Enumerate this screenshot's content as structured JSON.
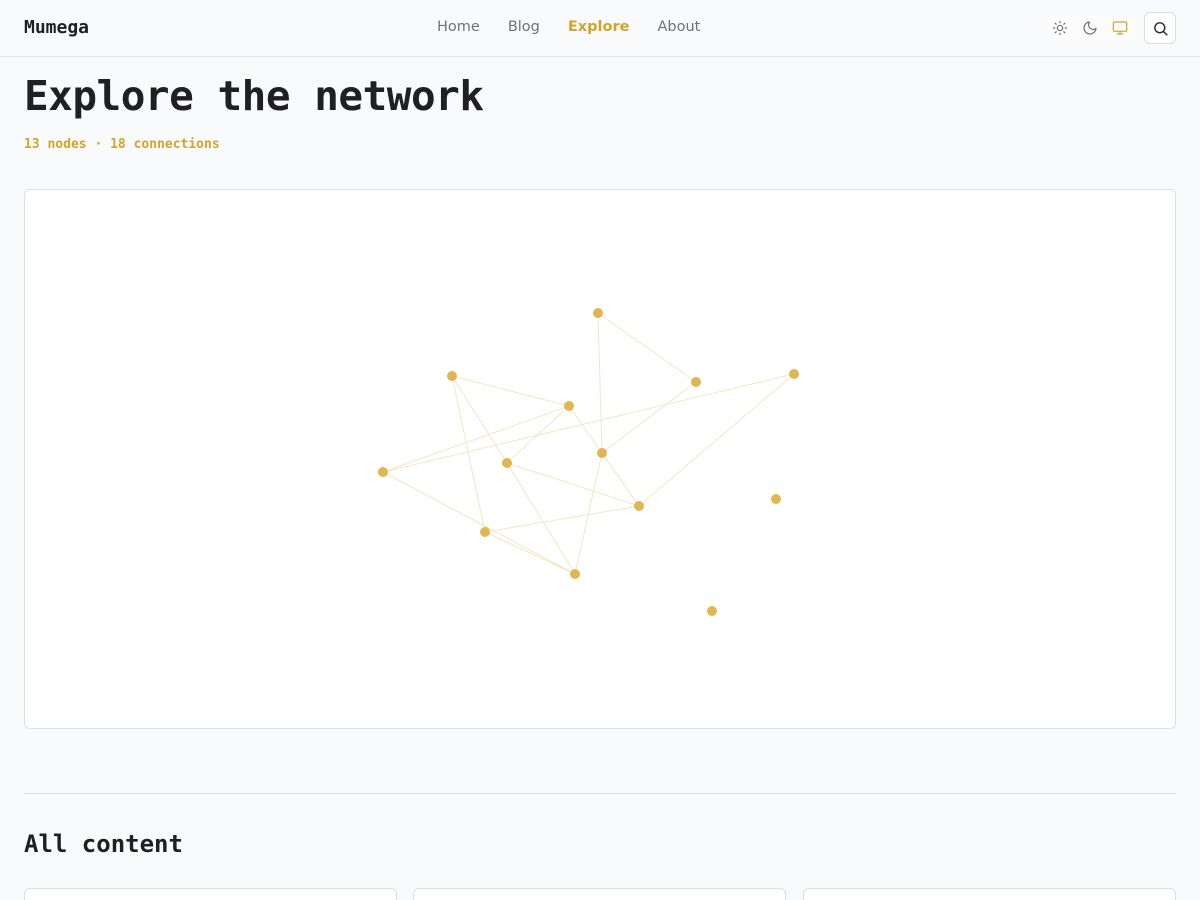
{
  "header": {
    "brand": "Mumega",
    "nav": [
      {
        "label": "Home",
        "active": false
      },
      {
        "label": "Blog",
        "active": false
      },
      {
        "label": "Explore",
        "active": true
      },
      {
        "label": "About",
        "active": false
      }
    ],
    "theme_toggle": {
      "options": [
        "sun-icon",
        "moon-icon",
        "monitor-icon"
      ],
      "selected": "monitor-icon"
    },
    "search_icon": "search-icon"
  },
  "main": {
    "title": "Explore the network",
    "stats": "13 nodes · 18 connections"
  },
  "graph": {
    "node_color": "#e0b650",
    "edge_color": "#f3e6c4",
    "nodes": [
      "n1",
      "n2",
      "n3",
      "n4",
      "n5",
      "n6",
      "n7",
      "n8",
      "n9",
      "n10",
      "n11",
      "n12",
      "n13"
    ],
    "edges": [
      [
        "n1",
        "n3"
      ],
      [
        "n1",
        "n6"
      ],
      [
        "n3",
        "n6"
      ],
      [
        "n2",
        "n4"
      ],
      [
        "n2",
        "n5"
      ],
      [
        "n2",
        "n8"
      ],
      [
        "n4",
        "n5"
      ],
      [
        "n4",
        "n7"
      ],
      [
        "n4",
        "n9"
      ],
      [
        "n5",
        "n9"
      ],
      [
        "n5",
        "n10"
      ],
      [
        "n8",
        "n9"
      ],
      [
        "n8",
        "n10"
      ],
      [
        "n6",
        "n9"
      ],
      [
        "n6",
        "n10"
      ],
      [
        "n7",
        "n10"
      ],
      [
        "n7",
        "n11"
      ],
      [
        "n9",
        "n11"
      ]
    ]
  },
  "section": {
    "title": "All content"
  },
  "colors": {
    "accent": "#d4a32a",
    "text": "#1f1f24",
    "muted": "#71717a",
    "border": "#dedee2",
    "background": "#f9fafb"
  }
}
